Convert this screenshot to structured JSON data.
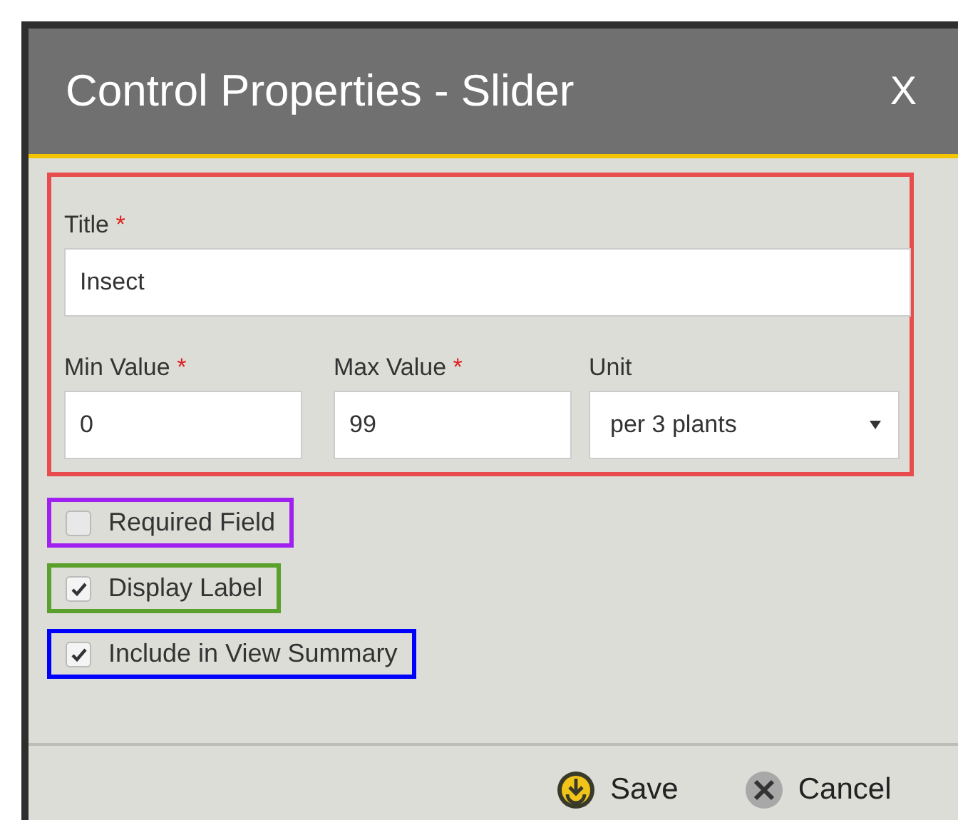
{
  "dialog": {
    "title": "Control Properties - Slider",
    "close": "X"
  },
  "fields_group": {
    "color": "#e84c4c",
    "title": {
      "label": "Title",
      "required_mark": "*",
      "value": "Insect"
    },
    "min": {
      "label": "Min Value",
      "required_mark": "*",
      "value": "0"
    },
    "max": {
      "label": "Max Value",
      "required_mark": "*",
      "value": "99"
    },
    "unit": {
      "label": "Unit",
      "value": "per 3 plants"
    }
  },
  "options": [
    {
      "label": "Required Field",
      "checked": false,
      "color": "#a020f0"
    },
    {
      "label": "Display Label",
      "checked": true,
      "color": "#5aa02c"
    },
    {
      "label": "Include in View Summary",
      "checked": true,
      "color": "#0000ff"
    }
  ],
  "buttons": [
    {
      "kind": "save",
      "label": "Save"
    },
    {
      "kind": "cancel",
      "label": "Cancel"
    }
  ]
}
